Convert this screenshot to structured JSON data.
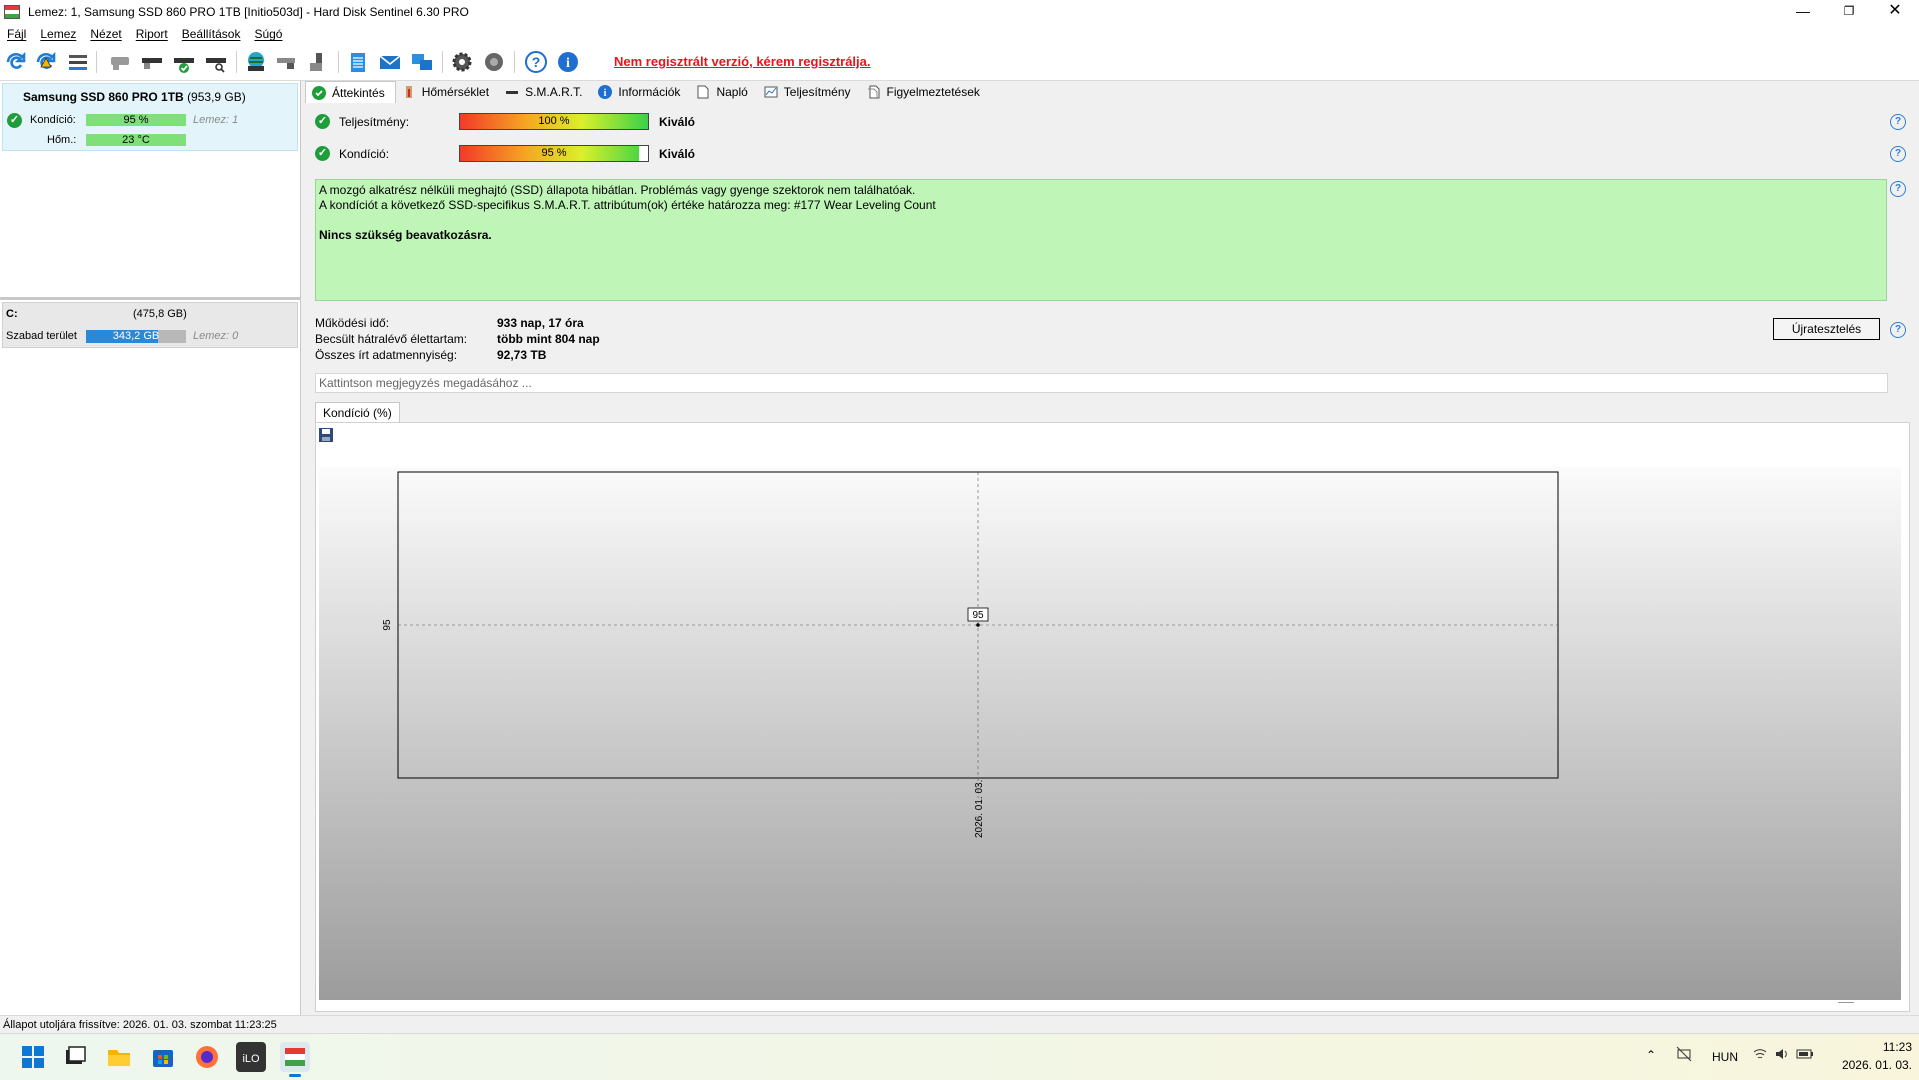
{
  "window": {
    "title": "Lemez: 1, Samsung SSD 860 PRO 1TB [Initio503d]  -  Hard Disk Sentinel 6.30 PRO",
    "minimize_icon": "minimize-icon",
    "maximize_icon": "restore-icon",
    "close_icon": "close-icon"
  },
  "menu": [
    "Fájl",
    "Lemez",
    "Nézet",
    "Riport",
    "Beállítások",
    "Súgó"
  ],
  "toolbar": {
    "registration_warning": "Nem regisztrált verzió, kérem regisztrálja.",
    "icons": [
      "refresh-icon",
      "refresh-warning-icon",
      "disk-list-icon",
      "disk-gray-icon",
      "disk-drive-icon",
      "disk-check-icon",
      "disk-search-icon",
      "globe-disk-icon",
      "network-disk-icon",
      "usb-disk-icon",
      "notepad-icon",
      "mail-icon",
      "network-icon",
      "settings-icon",
      "speaker-icon",
      "help-icon",
      "info-icon"
    ]
  },
  "left_panel": {
    "disk_name": "Samsung SSD 860 PRO 1TB",
    "disk_size": "(953,9 GB)",
    "condition_label": "Kondíció:",
    "condition_value": "95 %",
    "disk_index": "Lemez: 1",
    "temp_label": "Hőm.:",
    "temp_value": "23 °C",
    "volume_letter": "C:",
    "volume_size": "(475,8 GB)",
    "free_label": "Szabad terület",
    "free_value": "343,2 GB",
    "free_disk": "Lemez: 0",
    "free_fraction": 0.72
  },
  "tabs": [
    {
      "label": "Áttekintés",
      "icon": "check-icon",
      "active": true
    },
    {
      "label": "Hőmérséklet",
      "icon": "thermometer-icon"
    },
    {
      "label": "S.M.A.R.T.",
      "icon": "smart-disk-icon"
    },
    {
      "label": "Információk",
      "icon": "info-icon"
    },
    {
      "label": "Napló",
      "icon": "log-page-icon"
    },
    {
      "label": "Teljesítmény",
      "icon": "performance-chart-icon"
    },
    {
      "label": "Figyelmeztetések",
      "icon": "warnings-page-icon"
    }
  ],
  "overview": {
    "performance_label": "Teljesítmény:",
    "performance_value": "100 %",
    "performance_rating": "Kiváló",
    "performance_fraction": 1.0,
    "condition_label": "Kondíció:",
    "condition_value": "95 %",
    "condition_rating": "Kiváló",
    "condition_fraction": 0.95,
    "status_line1": "A mozgó alkatrész nélküli meghajtó (SSD) állapota hibátlan. Problémás vagy gyenge szektorok nem találhatóak.",
    "status_line2": "A kondíciót a következő SSD-specifikus S.M.A.R.T. attribútum(ok) értéke határozza meg:  #177 Wear Leveling Count",
    "status_line3": "Nincs szükség beavatkozásra.",
    "uptime_label": "Működési idő:",
    "uptime_value": "933 nap, 17 óra",
    "lifetime_label": "Becsült hátralévő élettartam:",
    "lifetime_value": "több mint 804 nap",
    "written_label": "Összes írt adatmennyiség:",
    "written_value": "92,73 TB",
    "retest_button": "Újratesztelés",
    "note_placeholder": "Kattintson megjegyzés megadásához ...",
    "chart_tab": "Kondíció  (%)"
  },
  "chart_data": {
    "type": "line",
    "x": [
      "2026. 01. 03."
    ],
    "series": [
      {
        "values": [
          95
        ]
      }
    ],
    "y_tick_labels": [
      "95"
    ],
    "x_tick_labels": [
      "2026. 01. 03."
    ],
    "data_labels": [
      "95"
    ],
    "grid": true
  },
  "statusbar": {
    "text": "Állapot utoljára frissítve: 2026. 01. 03. szombat 11:23:25"
  },
  "taskbar": {
    "apps": [
      "windows-start-icon",
      "file-explorer-window-icon",
      "folder-icon",
      "store-icon",
      "firefox-icon",
      "ilo-app-icon",
      "hard-disk-sentinel-icon"
    ],
    "language": "HUN",
    "time": "11:23",
    "date": "2026. 01. 03."
  }
}
